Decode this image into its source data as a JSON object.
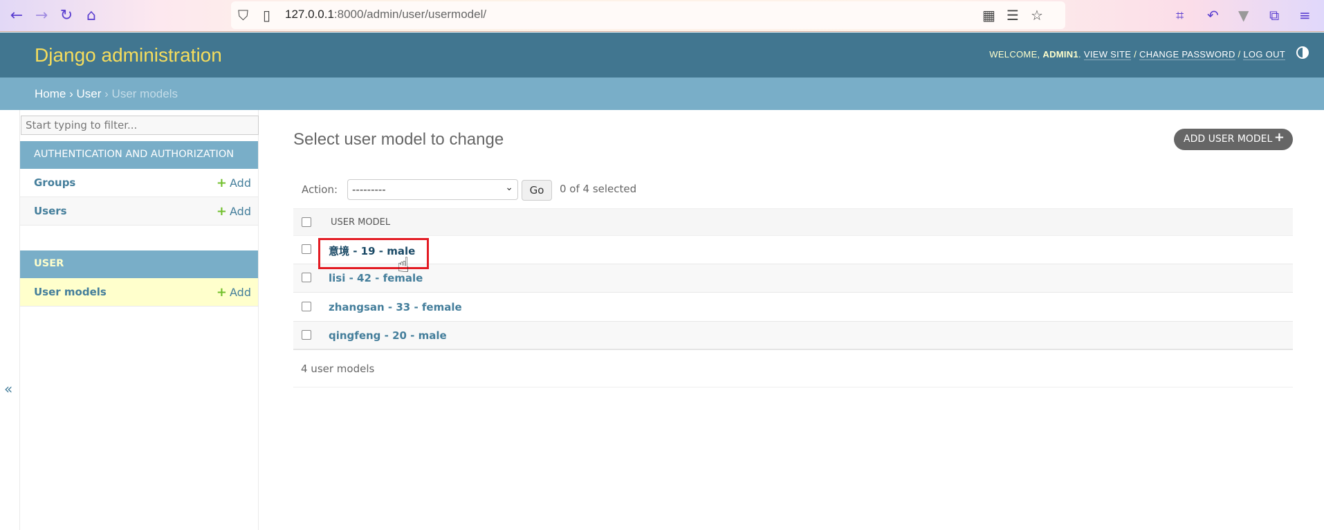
{
  "browser": {
    "url_host": "127.0.0.1",
    "url_rest": ":8000/admin/user/usermodel/"
  },
  "header": {
    "brand": "Django administration",
    "welcome": "WELCOME,",
    "user": "ADMIN1",
    "view_site": "VIEW SITE",
    "change_password": "CHANGE PASSWORD",
    "log_out": "LOG OUT"
  },
  "breadcrumbs": {
    "home": "Home",
    "app": "User",
    "current": "User models",
    "sep": "›"
  },
  "sidebar": {
    "filter_placeholder": "Start typing to filter...",
    "apps": [
      {
        "caption": "AUTHENTICATION AND AUTHORIZATION",
        "models": [
          {
            "name": "Groups",
            "add": "Add"
          },
          {
            "name": "Users",
            "add": "Add"
          }
        ]
      },
      {
        "caption": "USER",
        "models": [
          {
            "name": "User models",
            "add": "Add"
          }
        ]
      }
    ],
    "collapse": "«"
  },
  "main": {
    "title": "Select user model to change",
    "add_button": "ADD USER MODEL",
    "action_label": "Action:",
    "action_value": "---------",
    "go": "Go",
    "selected": "0 of 4 selected",
    "column": "USER MODEL",
    "rows": [
      "意境 - 19 - male",
      "lisi - 42 - female",
      "zhangsan - 33 - female",
      "qingfeng - 20 - male"
    ],
    "count": "4 user models"
  },
  "colors": {
    "header": "#417690",
    "breadcrumb": "#79aec8",
    "brand": "#f5dd5d",
    "link": "#447e9b",
    "highlight": "#e31b23"
  }
}
